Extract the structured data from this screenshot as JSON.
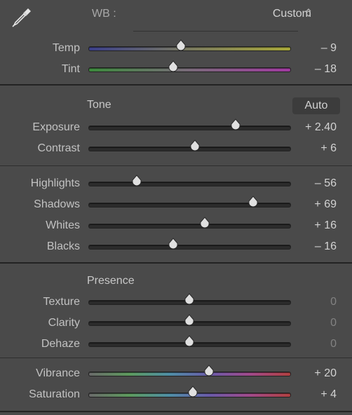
{
  "white_balance": {
    "label": "WB :",
    "selected": "Custom",
    "caret_icon": "updown-chevron-icon",
    "picker_icon": "eyedropper-icon",
    "sliders": [
      {
        "label": "Temp",
        "value": "– 9",
        "level": 0.46,
        "track": "temp"
      },
      {
        "label": "Tint",
        "value": "– 18",
        "level": 0.42,
        "track": "tint"
      }
    ]
  },
  "tone": {
    "title": "Tone",
    "auto_label": "Auto",
    "sliders": [
      {
        "label": "Exposure",
        "value": "+ 2.40",
        "level": 0.73
      },
      {
        "label": "Contrast",
        "value": "+ 6",
        "level": 0.53
      }
    ],
    "sliders2": [
      {
        "label": "Highlights",
        "value": "– 56",
        "level": 0.24
      },
      {
        "label": "Shadows",
        "value": "+ 69",
        "level": 0.82
      },
      {
        "label": "Whites",
        "value": "+ 16",
        "level": 0.58
      },
      {
        "label": "Blacks",
        "value": "– 16",
        "level": 0.42
      }
    ]
  },
  "presence": {
    "title": "Presence",
    "sliders": [
      {
        "label": "Texture",
        "value": "0",
        "level": 0.5
      },
      {
        "label": "Clarity",
        "value": "0",
        "level": 0.5
      },
      {
        "label": "Dehaze",
        "value": "0",
        "level": 0.5
      }
    ],
    "sliders2": [
      {
        "label": "Vibrance",
        "value": "+ 20",
        "level": 0.6,
        "track": "vib"
      },
      {
        "label": "Saturation",
        "value": "+ 4",
        "level": 0.52,
        "track": "sat"
      }
    ]
  }
}
